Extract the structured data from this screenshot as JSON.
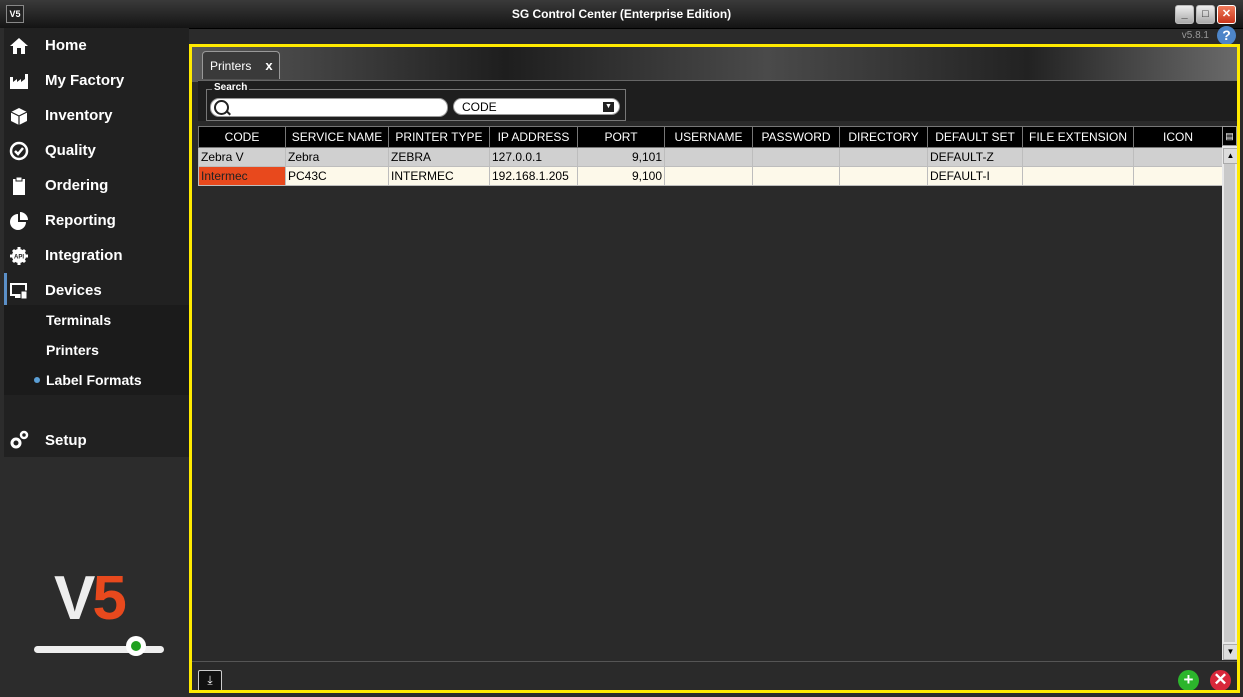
{
  "window": {
    "title": "SG Control Center (Enterprise Edition)",
    "app_icon": "V5",
    "version": "v5.8.1",
    "help_label": "?"
  },
  "sidebar": {
    "items": [
      {
        "label": "Home",
        "icon": "home-icon"
      },
      {
        "label": "My Factory",
        "icon": "factory-icon"
      },
      {
        "label": "Inventory",
        "icon": "box-icon"
      },
      {
        "label": "Quality",
        "icon": "check-circle-icon"
      },
      {
        "label": "Ordering",
        "icon": "clipboard-icon"
      },
      {
        "label": "Reporting",
        "icon": "pie-chart-icon"
      },
      {
        "label": "Integration",
        "icon": "api-gear-icon"
      },
      {
        "label": "Devices",
        "icon": "monitor-icon"
      }
    ],
    "sub_items": [
      {
        "label": "Terminals"
      },
      {
        "label": "Printers"
      },
      {
        "label": "Label Formats"
      }
    ],
    "setup": {
      "label": "Setup",
      "icon": "gears-icon"
    },
    "logo": {
      "v": "V",
      "five": "5"
    }
  },
  "main": {
    "tab": {
      "label": "Printers",
      "close": "x"
    },
    "search": {
      "legend": "Search",
      "value": "",
      "field": "CODE"
    },
    "table": {
      "columns": [
        "CODE",
        "SERVICE NAME",
        "PRINTER TYPE",
        "IP ADDRESS",
        "PORT",
        "USERNAME",
        "PASSWORD",
        "DIRECTORY",
        "DEFAULT SET",
        "FILE EXTENSION",
        "ICON"
      ],
      "rows": [
        {
          "code": "Zebra V",
          "service_name": "Zebra",
          "printer_type": "ZEBRA",
          "ip_address": "127.0.0.1",
          "port": "9,101",
          "username": "",
          "password": "",
          "directory": "",
          "default_set": "DEFAULT-Z",
          "file_extension": "",
          "icon": ""
        },
        {
          "code": "Intermec",
          "service_name": "PC43C",
          "printer_type": "INTERMEC",
          "ip_address": "192.168.1.205",
          "port": "9,100",
          "username": "",
          "password": "",
          "directory": "",
          "default_set": "DEFAULT-I",
          "file_extension": "",
          "icon": ""
        }
      ]
    }
  },
  "colors": {
    "highlight": "#e8491d",
    "frame": "#ffea00",
    "add": "#2cb52c",
    "delete": "#d8283a"
  }
}
